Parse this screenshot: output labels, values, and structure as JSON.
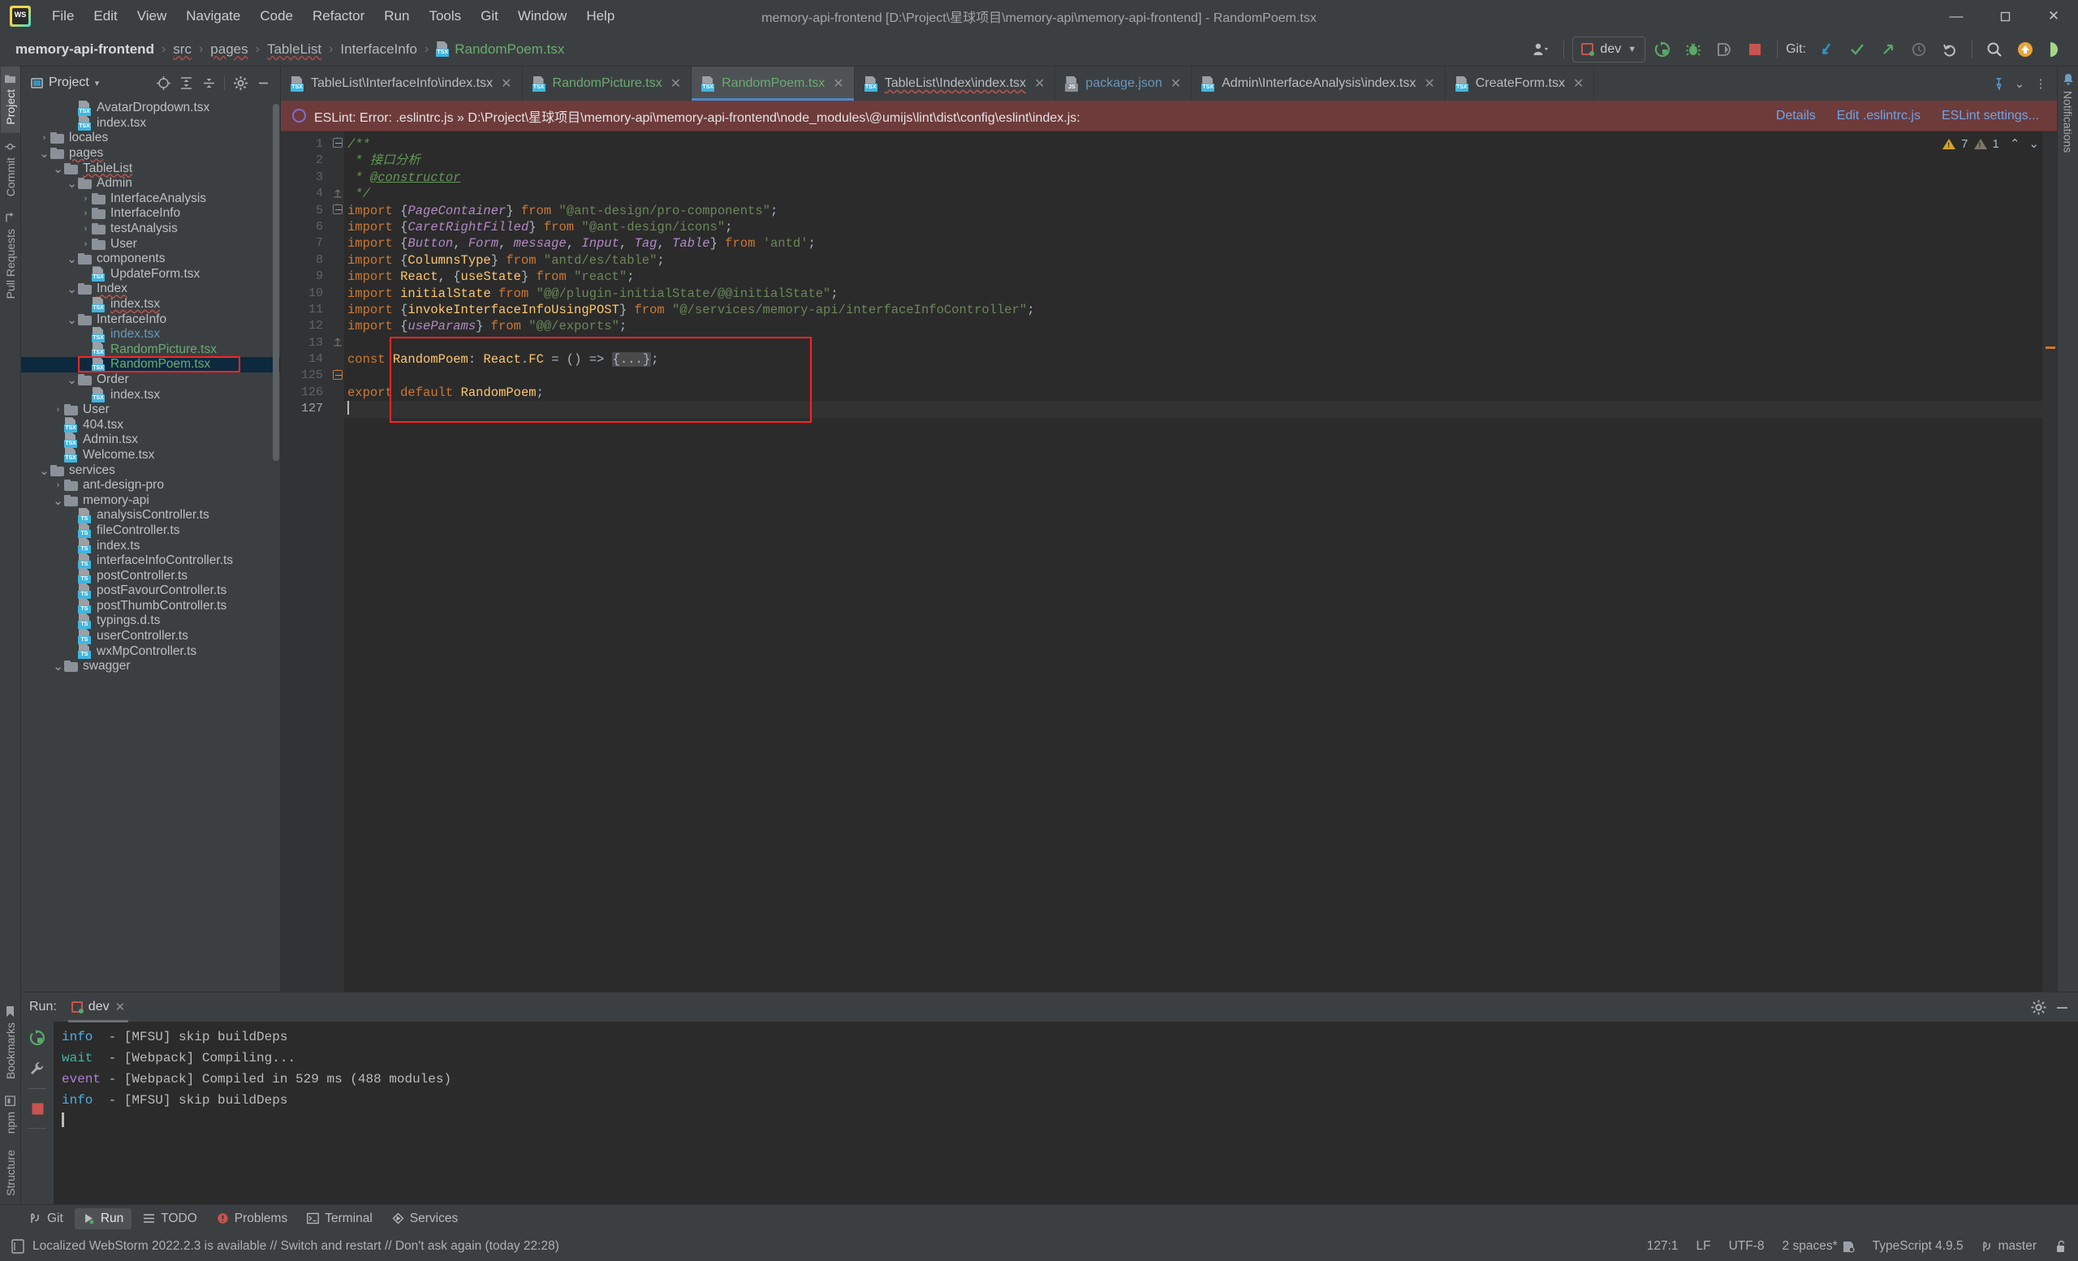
{
  "window": {
    "title": "memory-api-frontend [D:\\Project\\星球项目\\memory-api\\memory-api-frontend] - RandomPoem.tsx",
    "minimize": "—",
    "maximize": "❐",
    "close": "✕"
  },
  "menu": [
    {
      "label": "File"
    },
    {
      "label": "Edit"
    },
    {
      "label": "View"
    },
    {
      "label": "Navigate"
    },
    {
      "label": "Code"
    },
    {
      "label": "Refactor"
    },
    {
      "label": "Run"
    },
    {
      "label": "Tools"
    },
    {
      "label": "Git"
    },
    {
      "label": "Window"
    },
    {
      "label": "Help"
    }
  ],
  "breadcrumb": {
    "project": "memory-api-frontend",
    "sep": "›",
    "items": [
      "src",
      "pages",
      "TableList",
      "InterfaceInfo"
    ],
    "file": "RandomPoem.tsx"
  },
  "toolbar": {
    "run_config": "dev",
    "git_label": "Git:",
    "icons": [
      "user-dropdown-icon",
      "run-icon",
      "debug-icon",
      "coverage-icon",
      "stop-icon",
      "git-update-icon",
      "git-commit-icon",
      "git-push-icon",
      "git-history-icon",
      "git-rollback-icon",
      "search-everywhere-icon",
      "updates-icon",
      "ide-feature-icon"
    ]
  },
  "left_rail": {
    "top": [
      {
        "label": "Project",
        "icon": "folder-icon",
        "active": true
      },
      {
        "label": "Commit",
        "icon": "commit-icon",
        "active": false
      },
      {
        "label": "Pull Requests",
        "icon": "pull-request-icon",
        "active": false
      }
    ],
    "bottom": [
      {
        "label": "Bookmarks",
        "icon": "bookmark-icon"
      },
      {
        "label": "npm",
        "icon": "npm-icon"
      },
      {
        "label": "Structure",
        "icon": "structure-icon"
      }
    ]
  },
  "notifications_rail": {
    "label": "Notifications"
  },
  "project_panel": {
    "title": "Project",
    "chevron": "▾",
    "tools": [
      "locate-icon",
      "expand-all-icon",
      "collapse-all-icon",
      "settings-icon",
      "hide-icon"
    ],
    "tree": [
      {
        "depth": 5,
        "type": "file",
        "kind": "tsx",
        "label": "AvatarDropdown.tsx"
      },
      {
        "depth": 5,
        "type": "file",
        "kind": "tsx",
        "label": "index.tsx"
      },
      {
        "depth": 3,
        "type": "folder",
        "state": "collapsed",
        "label": "locales"
      },
      {
        "depth": 3,
        "type": "folder",
        "state": "expanded",
        "label": "pages",
        "wavy": true
      },
      {
        "depth": 4,
        "type": "folder",
        "state": "expanded",
        "label": "TableList",
        "wavy": true
      },
      {
        "depth": 5,
        "type": "folder",
        "state": "expanded",
        "label": "Admin"
      },
      {
        "depth": 6,
        "type": "folder",
        "state": "collapsed",
        "label": "InterfaceAnalysis"
      },
      {
        "depth": 6,
        "type": "folder",
        "state": "collapsed",
        "label": "InterfaceInfo"
      },
      {
        "depth": 6,
        "type": "folder",
        "state": "collapsed",
        "label": "testAnalysis"
      },
      {
        "depth": 6,
        "type": "folder",
        "state": "collapsed",
        "label": "User"
      },
      {
        "depth": 5,
        "type": "folder",
        "state": "expanded",
        "label": "components"
      },
      {
        "depth": 6,
        "type": "file",
        "kind": "tsx",
        "label": "UpdateForm.tsx"
      },
      {
        "depth": 5,
        "type": "folder",
        "state": "expanded",
        "label": "Index",
        "wavy": true
      },
      {
        "depth": 6,
        "type": "file",
        "kind": "tsx",
        "label": "index.tsx",
        "wavy": true
      },
      {
        "depth": 5,
        "type": "folder",
        "state": "expanded",
        "label": "InterfaceInfo"
      },
      {
        "depth": 6,
        "type": "file",
        "kind": "tsx",
        "label": "index.tsx",
        "color": "blue"
      },
      {
        "depth": 6,
        "type": "file",
        "kind": "tsx",
        "label": "RandomPicture.tsx",
        "color": "green"
      },
      {
        "depth": 6,
        "type": "file",
        "kind": "tsx",
        "label": "RandomPoem.tsx",
        "color": "green",
        "selected": true,
        "annotated": true
      },
      {
        "depth": 5,
        "type": "folder",
        "state": "expanded",
        "label": "Order"
      },
      {
        "depth": 6,
        "type": "file",
        "kind": "tsx",
        "label": "index.tsx"
      },
      {
        "depth": 4,
        "type": "folder",
        "state": "collapsed",
        "label": "User"
      },
      {
        "depth": 4,
        "type": "file",
        "kind": "tsx",
        "label": "404.tsx"
      },
      {
        "depth": 4,
        "type": "file",
        "kind": "tsx",
        "label": "Admin.tsx"
      },
      {
        "depth": 4,
        "type": "file",
        "kind": "tsx",
        "label": "Welcome.tsx"
      },
      {
        "depth": 3,
        "type": "folder",
        "state": "expanded",
        "label": "services"
      },
      {
        "depth": 4,
        "type": "folder",
        "state": "collapsed",
        "label": "ant-design-pro"
      },
      {
        "depth": 4,
        "type": "folder",
        "state": "expanded",
        "label": "memory-api"
      },
      {
        "depth": 5,
        "type": "file",
        "kind": "ts",
        "label": "analysisController.ts"
      },
      {
        "depth": 5,
        "type": "file",
        "kind": "ts",
        "label": "fileController.ts"
      },
      {
        "depth": 5,
        "type": "file",
        "kind": "ts",
        "label": "index.ts"
      },
      {
        "depth": 5,
        "type": "file",
        "kind": "ts",
        "label": "interfaceInfoController.ts"
      },
      {
        "depth": 5,
        "type": "file",
        "kind": "ts",
        "label": "postController.ts"
      },
      {
        "depth": 5,
        "type": "file",
        "kind": "ts",
        "label": "postFavourController.ts"
      },
      {
        "depth": 5,
        "type": "file",
        "kind": "ts",
        "label": "postThumbController.ts"
      },
      {
        "depth": 5,
        "type": "file",
        "kind": "ts",
        "label": "typings.d.ts"
      },
      {
        "depth": 5,
        "type": "file",
        "kind": "ts",
        "label": "userController.ts"
      },
      {
        "depth": 5,
        "type": "file",
        "kind": "ts",
        "label": "wxMpController.ts"
      },
      {
        "depth": 4,
        "type": "folder",
        "state": "expanded",
        "label": "swagger"
      }
    ]
  },
  "editor_tabs": [
    {
      "label": "TableList\\InterfaceInfo\\index.tsx",
      "kind": "tsx",
      "active": false,
      "color": "default"
    },
    {
      "label": "RandomPicture.tsx",
      "kind": "tsx",
      "active": false,
      "color": "green"
    },
    {
      "label": "RandomPoem.tsx",
      "kind": "tsx",
      "active": true,
      "color": "green"
    },
    {
      "label": "TableList\\Index\\index.tsx",
      "kind": "tsx",
      "active": false,
      "color": "default",
      "wavy": true
    },
    {
      "label": "package.json",
      "kind": "json",
      "active": false,
      "color": "blue"
    },
    {
      "label": "Admin\\InterfaceAnalysis\\index.tsx",
      "kind": "tsx",
      "active": false,
      "color": "default"
    },
    {
      "label": "CreateForm.tsx",
      "kind": "tsx",
      "active": false,
      "color": "default"
    }
  ],
  "tabs_overflow": {
    "close": "✕",
    "pin_icon": "pin-icon",
    "chevron": "⌄",
    "more": "⋮"
  },
  "eslint_banner": {
    "message": "ESLint: Error: .eslintrc.js » D:\\Project\\星球项目\\memory-api\\memory-api-frontend\\node_modules\\@umijs\\lint\\dist\\config\\eslint\\index.js:",
    "links": [
      "Details",
      "Edit .eslintrc.js",
      "ESLint settings..."
    ]
  },
  "inspections": {
    "warnings": "7",
    "weak_warnings": "1",
    "up": "⌃",
    "down": "⌄"
  },
  "code": {
    "line_numbers": [
      "1",
      "2",
      "3",
      "4",
      "5",
      "6",
      "7",
      "8",
      "9",
      "10",
      "11",
      "12",
      "13",
      "14",
      "125",
      "126",
      "127"
    ],
    "lines": [
      "/**",
      " * 接口分析",
      " * @constructor",
      " */",
      "import {PageContainer} from \"@ant-design/pro-components\";",
      "import {CaretRightFilled} from \"@ant-design/icons\";",
      "import {Button, Form, message, Input, Tag, Table} from 'antd';",
      "import {ColumnsType} from \"antd/es/table\";",
      "import React, {useState} from \"react\";",
      "import initialState from \"@@/plugin-initialState/@@initialState\";",
      "import {invokeInterfaceInfoUsingPOST} from \"@/services/memory-api/interfaceInfoController\";",
      "import {useParams} from \"@@/exports\";",
      "",
      "const RandomPoem: React.FC = () => {...};",
      "",
      "export default RandomPoem;",
      ""
    ]
  },
  "run_panel": {
    "label": "Run:",
    "tab": "dev",
    "tab_close": "✕",
    "side_icons": [
      "rerun-icon",
      "wrench-icon",
      "stop-icon"
    ],
    "header_icons": [
      "settings-icon",
      "minimize-icon"
    ],
    "console": [
      {
        "level": "info",
        "text": " - [MFSU] skip buildDeps"
      },
      {
        "level": "wait",
        "text": " - [Webpack] Compiling..."
      },
      {
        "level": "event",
        "text": " - [Webpack] Compiled in 529 ms (488 modules)"
      },
      {
        "level": "info",
        "text": " - [MFSU] skip buildDeps"
      }
    ]
  },
  "tool_strip": [
    {
      "label": "Git",
      "icon": "git-branch-icon",
      "active": false
    },
    {
      "label": "Run",
      "icon": "run-icon",
      "active": true
    },
    {
      "label": "TODO",
      "icon": "todo-icon",
      "active": false
    },
    {
      "label": "Problems",
      "icon": "problems-icon",
      "active": false
    },
    {
      "label": "Terminal",
      "icon": "terminal-icon",
      "active": false
    },
    {
      "label": "Services",
      "icon": "services-icon",
      "active": false
    }
  ],
  "status_bar": {
    "message": "Localized WebStorm 2022.2.3 is available // Switch and restart // Don't ask again (today 22:28)",
    "position": "127:1",
    "line_sep": "LF",
    "encoding": "UTF-8",
    "indent": "2 spaces*",
    "language": "TypeScript 4.9.5",
    "branch": "master",
    "lock_icon": "unlocked-icon"
  },
  "colors": {
    "accent": "#4a88c7",
    "error": "#6e3b3b",
    "annotation": "#fb2424",
    "selection": "#0d293e",
    "green_file": "#6aab73",
    "blue_file": "#6897bb"
  }
}
